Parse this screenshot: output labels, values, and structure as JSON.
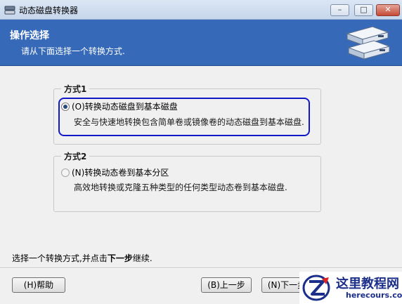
{
  "window": {
    "title": "动态磁盘转换器",
    "minimize_label": "–",
    "maximize_label": "□",
    "close_label": "✕"
  },
  "header": {
    "title": "操作选择",
    "subtitle": "请从下面选择一个转换方式."
  },
  "options": [
    {
      "group_label": "方式1",
      "option_label": "(O)转换动态磁盘到基本磁盘",
      "description": "安全与快速地转换包含简单卷或镜像卷的动态磁盘到基本磁盘.",
      "selected": true
    },
    {
      "group_label": "方式2",
      "option_label": "(N)转换动态卷到基本分区",
      "description": "高效地转换或克隆五种类型的任何类型动态卷到基本磁盘.",
      "selected": false
    }
  ],
  "footer": {
    "hint_prefix": "选择一个转换方式,并点击",
    "hint_bold": "下一步",
    "hint_suffix": "继续."
  },
  "buttons": {
    "help": "(H)帮助",
    "back": "(B)上一步",
    "next": "(N)下一步"
  },
  "watermark": {
    "title": "这里教程网",
    "url": "herecours.com"
  },
  "colors": {
    "header_bg": "#3669b8",
    "highlight_border": "#1018c8",
    "watermark_text": "#1a2e8a"
  }
}
